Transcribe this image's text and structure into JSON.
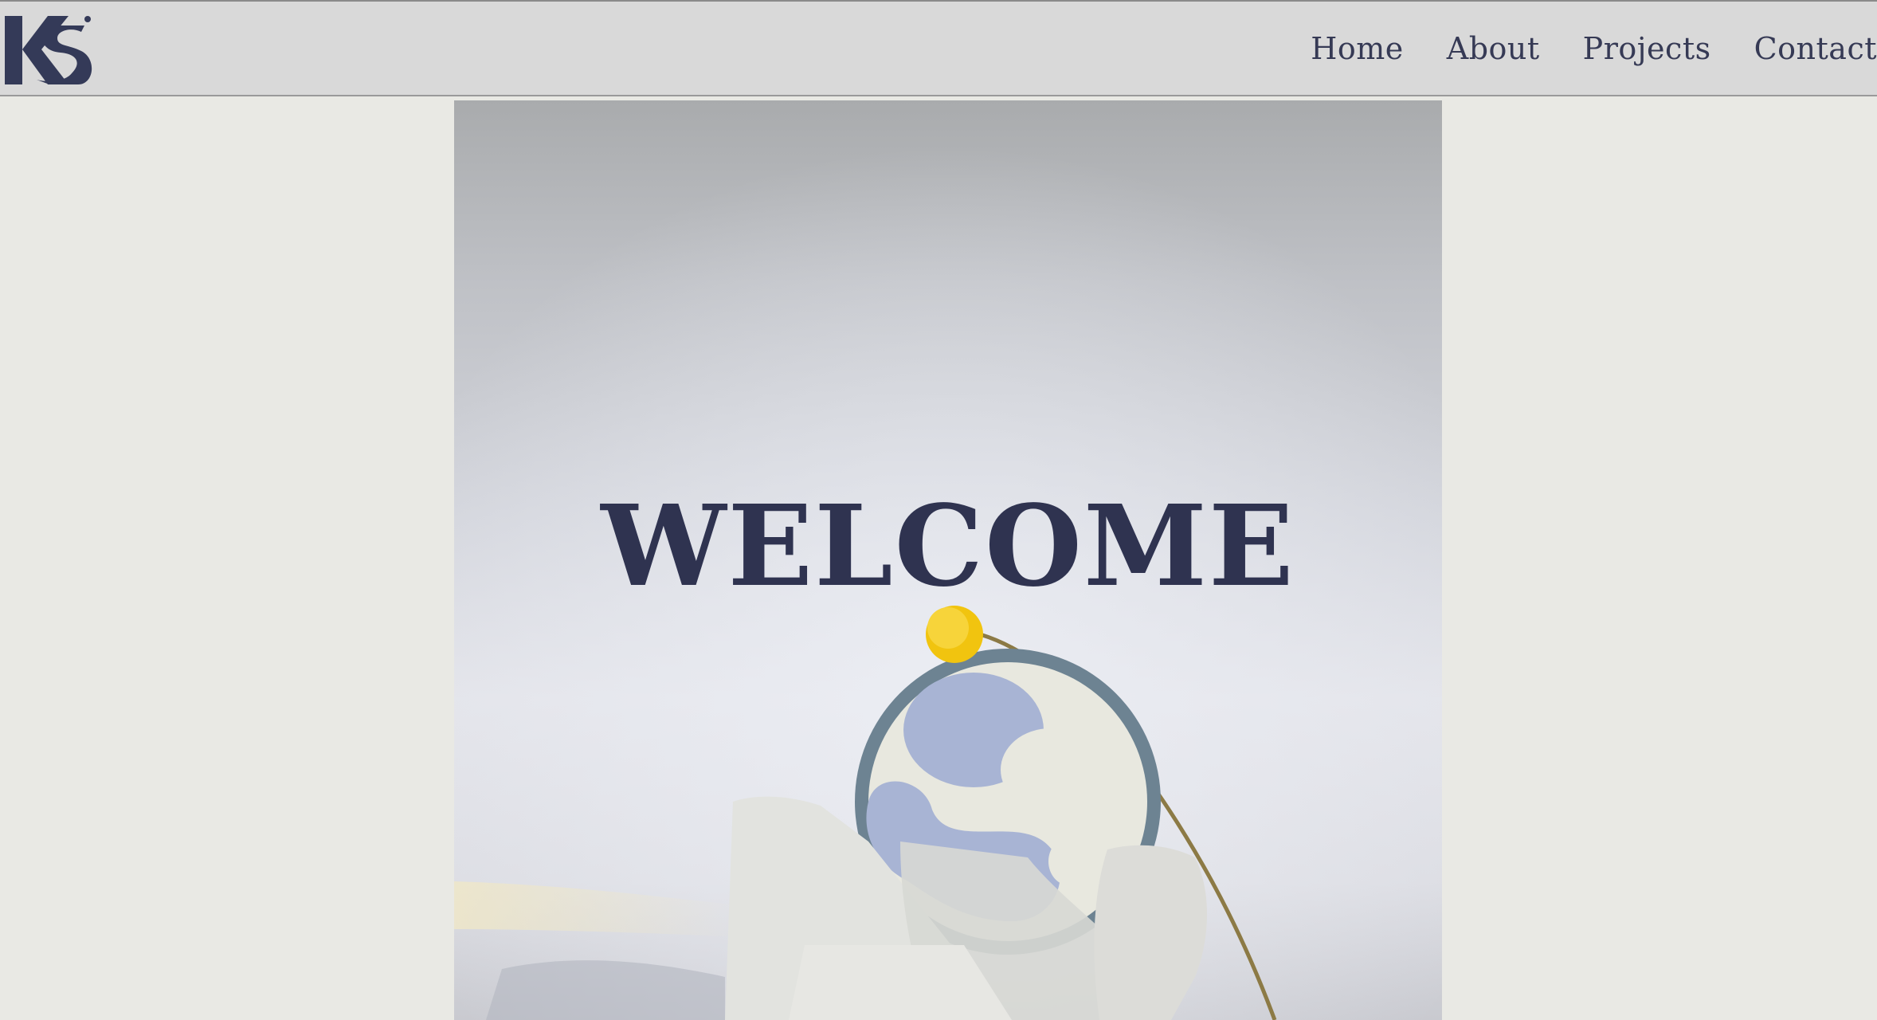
{
  "brand": {
    "logo_icon": "ks-monogram-icon",
    "color": "#343a58"
  },
  "nav": {
    "items": [
      {
        "label": "Home"
      },
      {
        "label": "About"
      },
      {
        "label": "Projects"
      },
      {
        "label": "Contact"
      }
    ]
  },
  "hero": {
    "heading": "WELCOME",
    "image": "concrete-coaster-with-yellow-flower-photo",
    "heading_color": "#2f3350"
  },
  "colors": {
    "page_background": "#e9e9e4",
    "header_background": "#d9d9d9",
    "nav_text": "#363a55"
  }
}
